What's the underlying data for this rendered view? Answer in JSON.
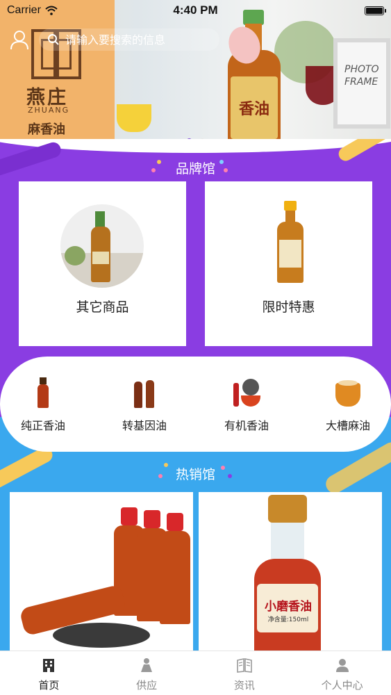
{
  "status_bar": {
    "carrier": "Carrier",
    "time": "4:40 PM"
  },
  "search": {
    "placeholder": "请输入要搜索的信息"
  },
  "banner": {
    "logo_text": "燕庄",
    "logo_pinyin": "ZHUANG",
    "logo_sub": "麻香油",
    "frame_text": "PHOTO FRAME",
    "bottle_label": "香油",
    "carousel": {
      "current": 1,
      "total": 2
    }
  },
  "brand_section": {
    "title": "品牌馆",
    "cards": [
      {
        "label": "其它商品",
        "image": "sesame-oil-bottle-photo"
      },
      {
        "label": "限时特惠",
        "image": "small-sesame-oil-bottle"
      }
    ]
  },
  "categories": [
    {
      "label": "纯正香油",
      "icon": "bottle-icon"
    },
    {
      "label": "转基因油",
      "icon": "two-bottles-icon"
    },
    {
      "label": "有机香油",
      "icon": "organic-oil-icon"
    },
    {
      "label": "大槽麻油",
      "icon": "oil-bowl-icon"
    }
  ],
  "hot_section": {
    "title": "热销馆",
    "cards": [
      {
        "image": "sesame-oil-bottles-with-seeds"
      },
      {
        "image": "xiaomo-sesame-oil-bottle",
        "label_text": "小磨香油",
        "volume": "净含量:150ml"
      }
    ]
  },
  "tabbar": [
    {
      "label": "首页",
      "icon": "home-building-icon",
      "active": true
    },
    {
      "label": "供应",
      "icon": "supply-person-icon",
      "active": false
    },
    {
      "label": "资讯",
      "icon": "news-book-icon",
      "active": false
    },
    {
      "label": "个人中心",
      "icon": "profile-icon",
      "active": false
    }
  ],
  "colors": {
    "brand_purple": "#8a3de2",
    "hot_blue": "#3aa8ee",
    "accent_yellow": "#f7c95a",
    "carousel_active": "#7c42d8"
  }
}
